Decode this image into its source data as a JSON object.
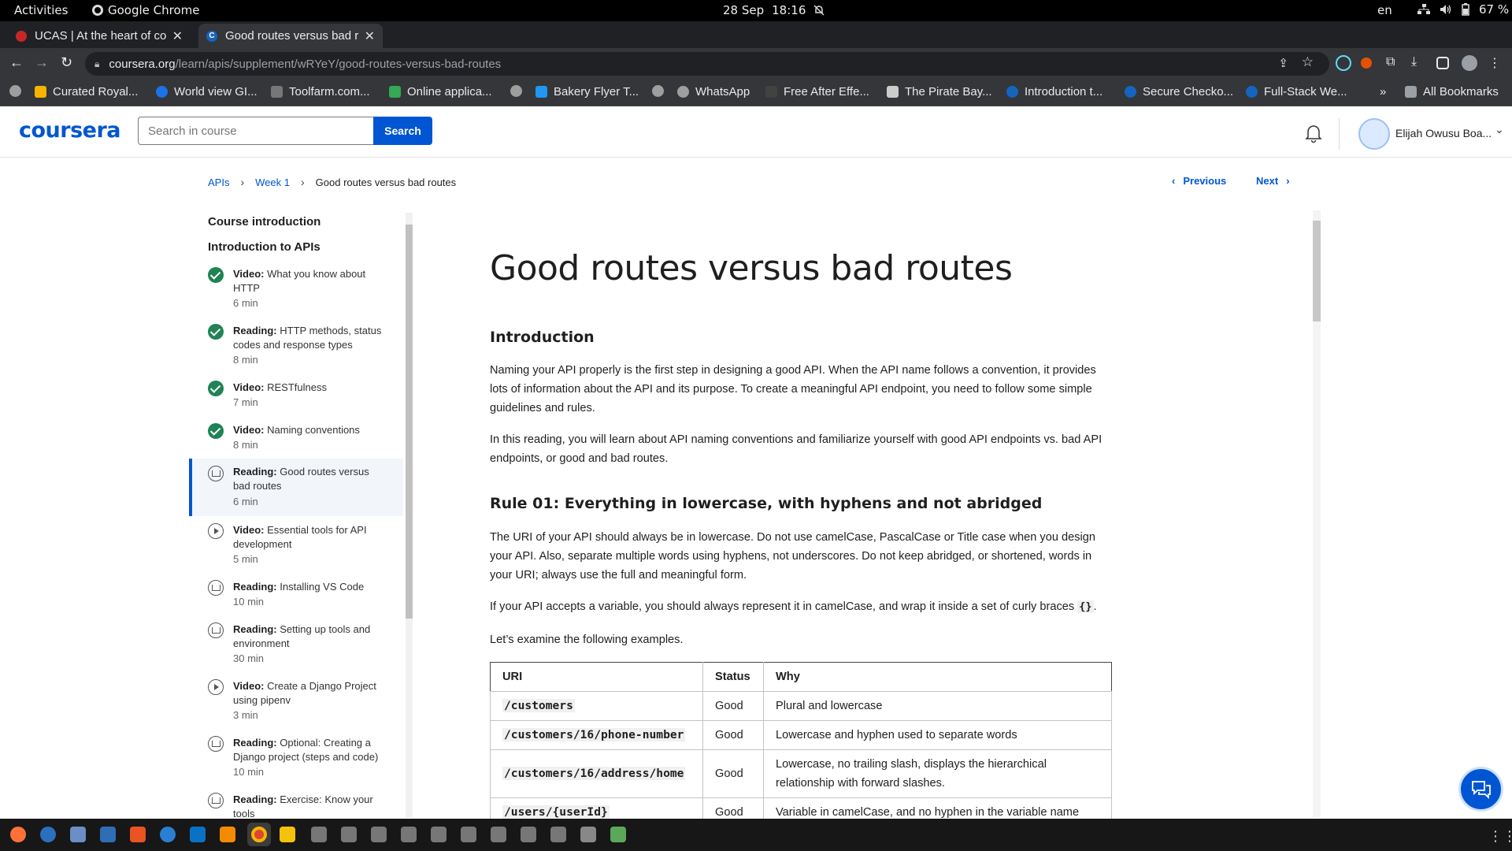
{
  "system": {
    "activities": "Activities",
    "app_name": "Google Chrome",
    "date": "28 Sep",
    "time": "18:16",
    "lang": "en",
    "battery": "67 %"
  },
  "tabs": [
    {
      "title": "UCAS | At the heart of connecting people",
      "active": false,
      "icon_color": "#c62828"
    },
    {
      "title": "Good routes versus bad routes",
      "active": true,
      "icon_color": "#1565c0"
    }
  ],
  "omnibox": {
    "host": "coursera.org",
    "path": "/learn/apis/supplement/wRYeY/good-routes-versus-bad-routes"
  },
  "bookmarks": [
    {
      "label": "Curated Royal...",
      "color": "#f4b400"
    },
    {
      "label": "World view GI...",
      "color": "#1a73e8"
    },
    {
      "label": "Toolfarm.com...",
      "color": "#777777"
    },
    {
      "label": "Online applica...",
      "color": "#34a853"
    },
    {
      "label": "Bakery Flyer T...",
      "color": "#2196f3"
    },
    {
      "label": "WhatsApp",
      "color": "#9e9e9e"
    },
    {
      "label": "Free After Effe...",
      "color": "#424242"
    },
    {
      "label": "The Pirate Bay...",
      "color": "#cccccc"
    },
    {
      "label": "Introduction t...",
      "color": "#1565c0"
    },
    {
      "label": "Secure Checko...",
      "color": "#1565c0"
    },
    {
      "label": "Full-Stack We...",
      "color": "#1565c0"
    }
  ],
  "all_bookmarks": "All Bookmarks",
  "header": {
    "logo": "coursera",
    "search_placeholder": "Search in course",
    "search_button": "Search",
    "user_name": "Elijah Owusu Boa..."
  },
  "breadcrumb": {
    "items": [
      "APIs",
      "Week 1"
    ],
    "current": "Good routes versus bad routes"
  },
  "pager": {
    "previous": "Previous",
    "next": "Next"
  },
  "sidebar": {
    "section1": "Course introduction",
    "section2": "Introduction to APIs",
    "items": [
      {
        "kind": "Video:",
        "title": "What you know about HTTP",
        "duration": "6 min",
        "status": "done"
      },
      {
        "kind": "Reading:",
        "title": "HTTP methods, status codes and response types",
        "duration": "8 min",
        "status": "done"
      },
      {
        "kind": "Video:",
        "title": "RESTfulness",
        "duration": "7 min",
        "status": "done"
      },
      {
        "kind": "Video:",
        "title": "Naming conventions",
        "duration": "8 min",
        "status": "done"
      },
      {
        "kind": "Reading:",
        "title": "Good routes versus bad routes",
        "duration": "6 min",
        "status": "active"
      },
      {
        "kind": "Video:",
        "title": "Essential tools for API development",
        "duration": "5 min",
        "status": "video"
      },
      {
        "kind": "Reading:",
        "title": "Installing VS Code",
        "duration": "10 min",
        "status": "reading"
      },
      {
        "kind": "Reading:",
        "title": "Setting up tools and environment",
        "duration": "30 min",
        "status": "reading"
      },
      {
        "kind": "Video:",
        "title": "Create a Django Project using pipenv",
        "duration": "3 min",
        "status": "video"
      },
      {
        "kind": "Reading:",
        "title": "Optional: Creating a Django project (steps and code)",
        "duration": "10 min",
        "status": "reading"
      },
      {
        "kind": "Reading:",
        "title": "Exercise: Know your tools",
        "duration": "",
        "status": "reading"
      }
    ]
  },
  "article": {
    "title": "Good routes versus bad routes",
    "intro_heading": "Introduction",
    "intro_p1": "Naming your API properly is the first step in designing a good API. When the API name follows a convention, it provides lots of information about the API and its purpose. To create a meaningful API endpoint, you need to follow some simple guidelines and rules.",
    "intro_p2": "In this reading, you will learn about API naming conventions and familiarize yourself with good API endpoints vs. bad API endpoints, or good and bad routes.",
    "rule1_heading": "Rule 01: Everything in lowercase, with hyphens and not abridged",
    "rule1_p1": "The URI of your API should always be in lowercase. Do not use camelCase, PascalCase or Title case when you design your API. Also, separate multiple words using hyphens, not underscores. Do not keep abridged, or shortened, words in your URI; always use the full and meaningful form.",
    "rule1_p2_text": "If your API accepts a variable, you should always represent it in camelCase, and wrap it inside a set of curly braces",
    "rule1_p2_code": "{}",
    "rule1_p3": "Let’s examine the following examples.",
    "table_headers": [
      "URI",
      "Status",
      "Why"
    ],
    "table_rows": [
      {
        "uri": "/customers",
        "status": "Good",
        "why": "Plural and lowercase"
      },
      {
        "uri": "/customers/16/phone-number",
        "status": "Good",
        "why": "Lowercase and hyphen used to separate words"
      },
      {
        "uri": "/customers/16/address/home",
        "status": "Good",
        "why": "Lowercase, no trailing slash, displays the hierarchical relationship with forward slashes."
      },
      {
        "uri": "/users/{userId}",
        "status": "Good",
        "why": "Variable in camelCase, and no hyphen in the variable name"
      }
    ]
  }
}
